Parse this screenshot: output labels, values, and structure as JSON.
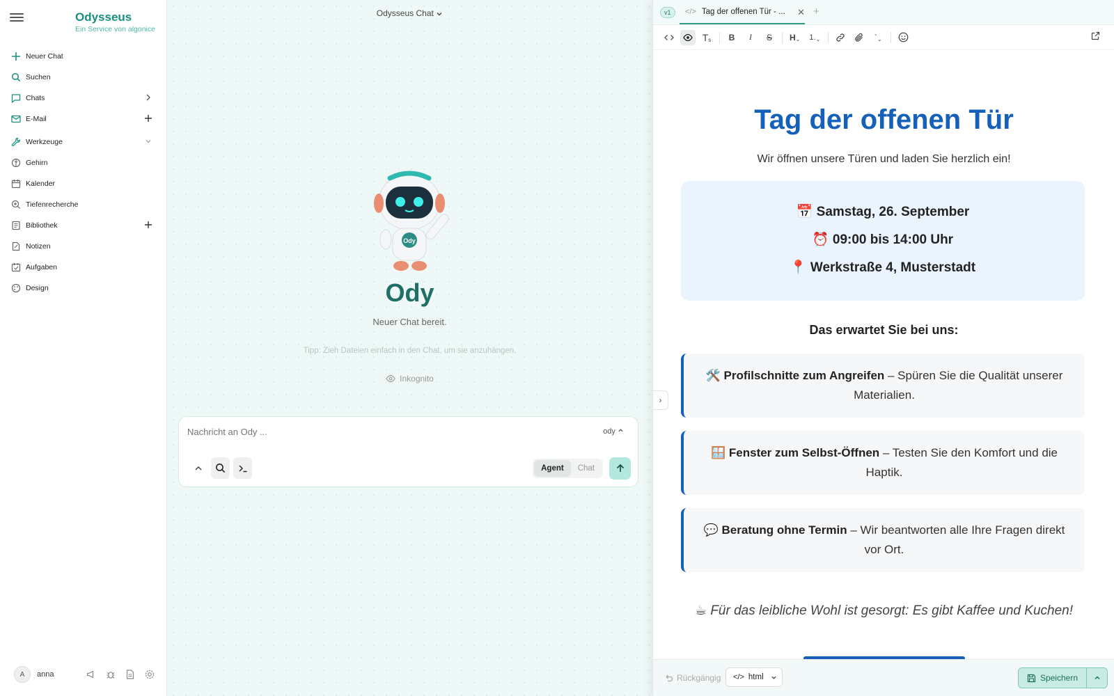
{
  "sidebar": {
    "brand_name": "Odysseus",
    "brand_sub": "Ein Service von algonice",
    "items": [
      {
        "label": "Neuer Chat",
        "icon": "plus-icon"
      },
      {
        "label": "Suchen",
        "icon": "search-icon"
      },
      {
        "label": "Chats",
        "icon": "chat-bubble-icon"
      },
      {
        "label": "E-Mail",
        "icon": "mail-icon"
      },
      {
        "label": "Werkzeuge",
        "icon": "wrench-icon"
      },
      {
        "label": "Gehirn",
        "icon": "brain-icon"
      },
      {
        "label": "Kalender",
        "icon": "calendar-icon"
      },
      {
        "label": "Tiefenrecherche",
        "icon": "deep-search-icon"
      },
      {
        "label": "Bibliothek",
        "icon": "book-icon"
      },
      {
        "label": "Notizen",
        "icon": "note-icon"
      },
      {
        "label": "Aufgaben",
        "icon": "tasks-icon"
      },
      {
        "label": "Design",
        "icon": "palette-icon"
      }
    ],
    "user": {
      "initial": "A",
      "name": "anna"
    }
  },
  "chat": {
    "title": "Odysseus Chat",
    "assistant_name": "Ody",
    "robot_badge": "Ody",
    "status": "Neuer Chat bereit.",
    "tip": "Tipp: Zieh Dateien einfach in den Chat, um sie anzuhängen.",
    "incognito": "Inkognito",
    "input_placeholder": "Nachricht an Ody ...",
    "model": "ody",
    "modes": {
      "agent": "Agent",
      "chat": "Chat",
      "active": "Agent"
    }
  },
  "panel": {
    "version": "v1",
    "tab_title": "Tag der offenen Tür - ...",
    "document": {
      "title": "Tag der offenen Tür",
      "subtitle": "Wir öffnen unsere Türen und laden Sie herzlich ein!",
      "date": "Samstag, 26. September",
      "time": "09:00 bis 14:00 Uhr",
      "address": "Werkstraße 4, Musterstadt",
      "section_heading": "Das erwartet Sie bei uns:",
      "features": [
        {
          "emoji": "🛠️",
          "title": "Profilschnitte zum Angreifen",
          "text": " – Spüren Sie die Qualität unserer Materialien."
        },
        {
          "emoji": "🪟",
          "title": "Fenster zum Selbst-Öffnen",
          "text": " – Testen Sie den Komfort und die Haptik."
        },
        {
          "emoji": "💬",
          "title": "Beratung ohne Termin",
          "text": " – Wir beantworten alle Ihre Fragen direkt vor Ort."
        }
      ],
      "note": "Für das leibliche Wohl ist gesorgt: Es gibt Kaffee und Kuchen!"
    },
    "bottom": {
      "undo": "Rückgängig",
      "language": "html",
      "save": "Speichern"
    }
  },
  "colors": {
    "accent": "#1a8f7e",
    "doc_blue": "#1560b8",
    "info_bg": "#eaf4fe"
  }
}
